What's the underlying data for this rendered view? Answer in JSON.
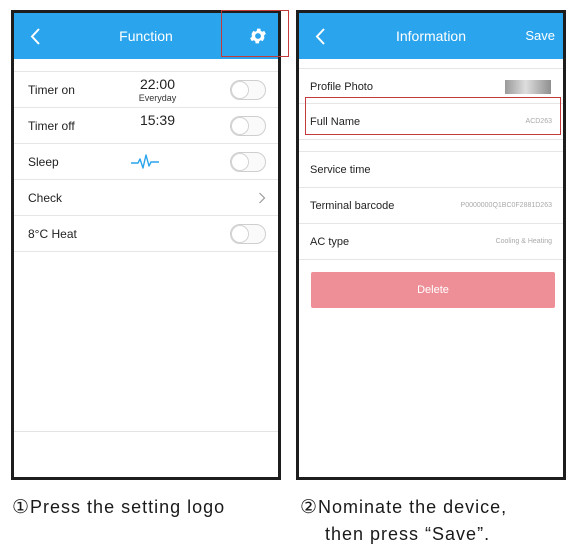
{
  "phone1": {
    "title": "Function",
    "rows": [
      {
        "label": "Timer on",
        "time": "22:00",
        "repeat": "Everyday"
      },
      {
        "label": "Timer off",
        "time": "15:39"
      },
      {
        "label": "Sleep"
      },
      {
        "label": "Check"
      },
      {
        "label": "8°C Heat"
      }
    ]
  },
  "phone2": {
    "title": "Information",
    "save_label": "Save",
    "rows": [
      {
        "label": "Profile Photo"
      },
      {
        "label": "Full Name",
        "value": "ACD263"
      },
      {
        "label": "Service time"
      },
      {
        "label": "Terminal barcode",
        "value": "P0000000Q1BC0F2881D263"
      },
      {
        "label": "AC type",
        "value": "Cooling & Heating"
      }
    ],
    "delete_label": "Delete"
  },
  "captions": {
    "step1_number": "①",
    "step1_text": "Press the setting logo",
    "step2_number": "②",
    "step2_line1": "Nominate the device,",
    "step2_line2": "then press “Save”."
  },
  "colors": {
    "header": "#2aa4ec",
    "delete": "#ee8f98",
    "highlight": "#c23a3a",
    "pulse": "#2aa4ec"
  },
  "icons": [
    "back-chevron-icon",
    "gear-icon",
    "pulse-icon",
    "chevron-right-icon"
  ]
}
